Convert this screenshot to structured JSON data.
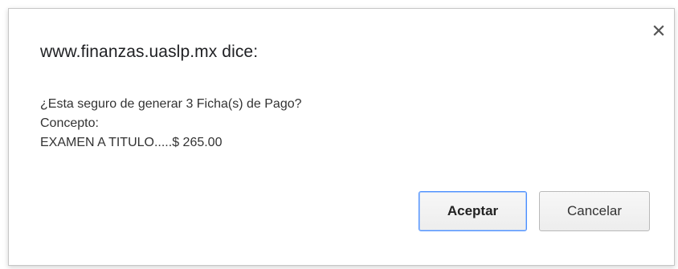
{
  "dialog": {
    "title": "www.finanzas.uaslp.mx dice:",
    "close_icon": "close-icon",
    "message": {
      "line1": "¿Esta seguro de generar 3 Ficha(s) de Pago?",
      "line2": "Concepto:",
      "line3": "EXAMEN A TITULO.....$ 265.00"
    },
    "buttons": {
      "accept_label": "Aceptar",
      "cancel_label": "Cancelar"
    },
    "colors": {
      "focus_border": "#4d90fe",
      "border": "#c6c6c6"
    }
  }
}
